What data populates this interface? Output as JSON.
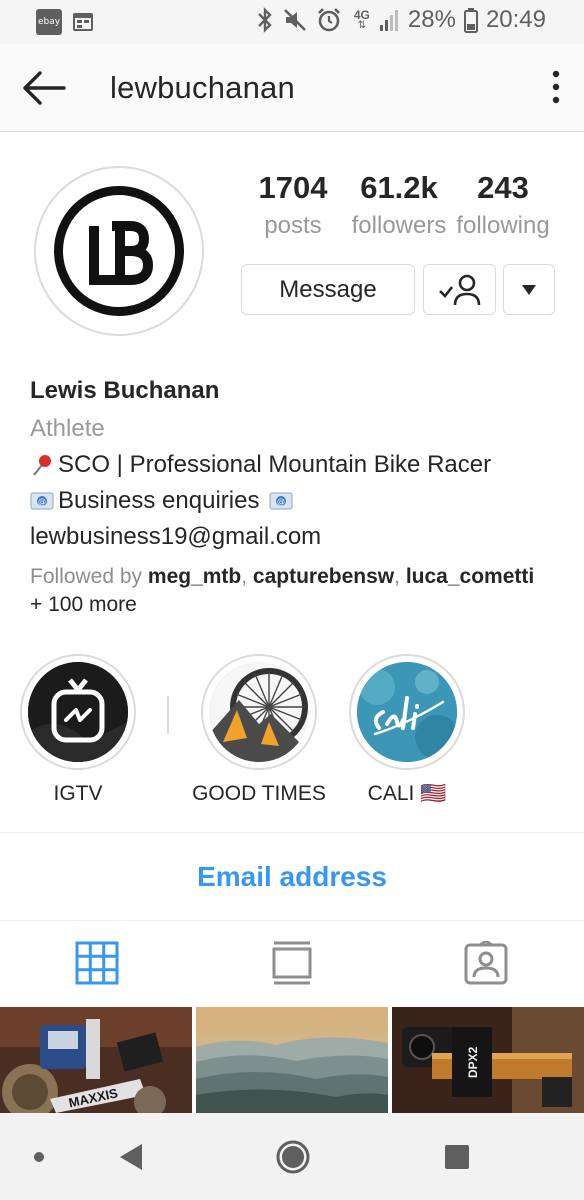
{
  "status_bar": {
    "left_badge": "ebay",
    "battery": "28%",
    "time": "20:49",
    "network": "4G",
    "icons": [
      "bluetooth-icon",
      "mute-icon",
      "alarm-icon",
      "signal-icon",
      "battery-icon"
    ]
  },
  "header": {
    "title": "lewbuchanan",
    "icons": [
      "back-arrow-icon",
      "more-vertical-icon"
    ]
  },
  "profile": {
    "stats": [
      {
        "value": "1704",
        "label": "posts"
      },
      {
        "value": "61.2k",
        "label": "followers"
      },
      {
        "value": "243",
        "label": "following"
      }
    ],
    "buttons": {
      "message": "Message",
      "following_icon": "person-check-icon",
      "dropdown_icon": "triangle-down-icon"
    }
  },
  "bio": {
    "name": "Lewis Buchanan",
    "category": "Athlete",
    "line1": "SCO | Professional Mountain Bike Racer",
    "line2": "Business enquiries",
    "line3": "lewbusiness19@gmail.com",
    "followed_prefix": "Followed by",
    "followers": [
      "meg_mtb",
      "capturebensw",
      "luca_cometti"
    ],
    "followed_sep": ", ",
    "followed_more": "+ 100 more"
  },
  "highlights": [
    {
      "label": "IGTV",
      "icon": "igtv-icon"
    },
    {
      "label": "GOOD TIMES",
      "icon": "mountain-wheel-icon"
    },
    {
      "label": "CALI 🇺🇸",
      "icon": "cali-icon"
    }
  ],
  "email_button": "Email address",
  "tabs": [
    {
      "name": "grid",
      "icon": "grid-icon",
      "active": true
    },
    {
      "name": "feed",
      "icon": "feed-icon",
      "active": false
    },
    {
      "name": "tagged",
      "icon": "tagged-person-icon",
      "active": false
    }
  ],
  "colors": {
    "accent": "#3897f0",
    "text": "#262626",
    "secondary": "#999999",
    "border": "#dbdbdb"
  },
  "nav": [
    "dot-icon",
    "back-triangle-icon",
    "home-circle-icon",
    "recents-square-icon"
  ]
}
